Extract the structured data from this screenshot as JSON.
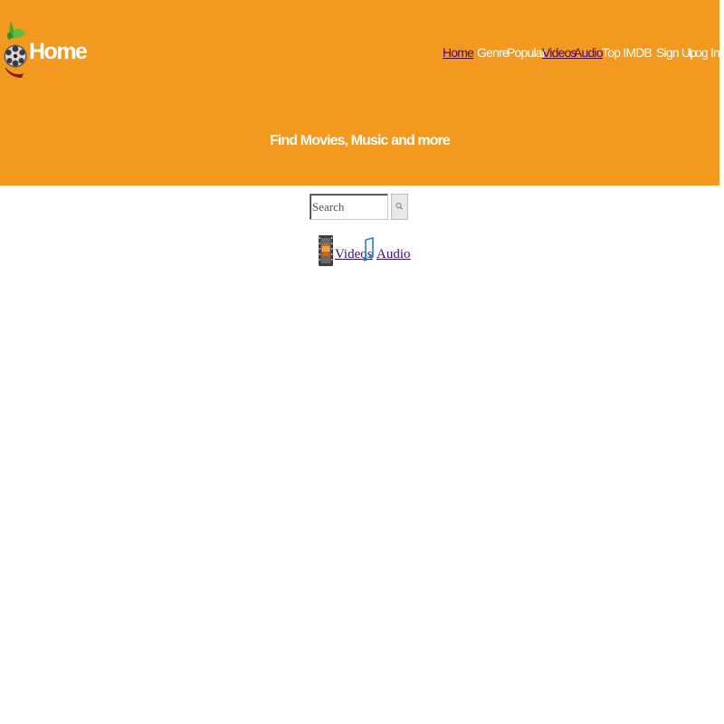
{
  "header": {
    "brand": "Home",
    "tagline": "Find Movies, Music and more",
    "colors": {
      "background": "#f39a1e",
      "link": "#4a0d56",
      "text": "#ffffff"
    }
  },
  "nav": {
    "home": "Home",
    "genre": "Genre",
    "popular": "Popular",
    "videos": "Videos",
    "audio": "Audio",
    "top_imdb": "Top IMDB",
    "sign_up": "Sign Up",
    "log_in": "Log In"
  },
  "search": {
    "placeholder": "Search",
    "value": "",
    "button_icon": "search-icon"
  },
  "media_links": {
    "videos": "Videos",
    "audio": "Audio",
    "videos_icon": "film-strip-icon",
    "audio_icon": "music-note-icon"
  }
}
